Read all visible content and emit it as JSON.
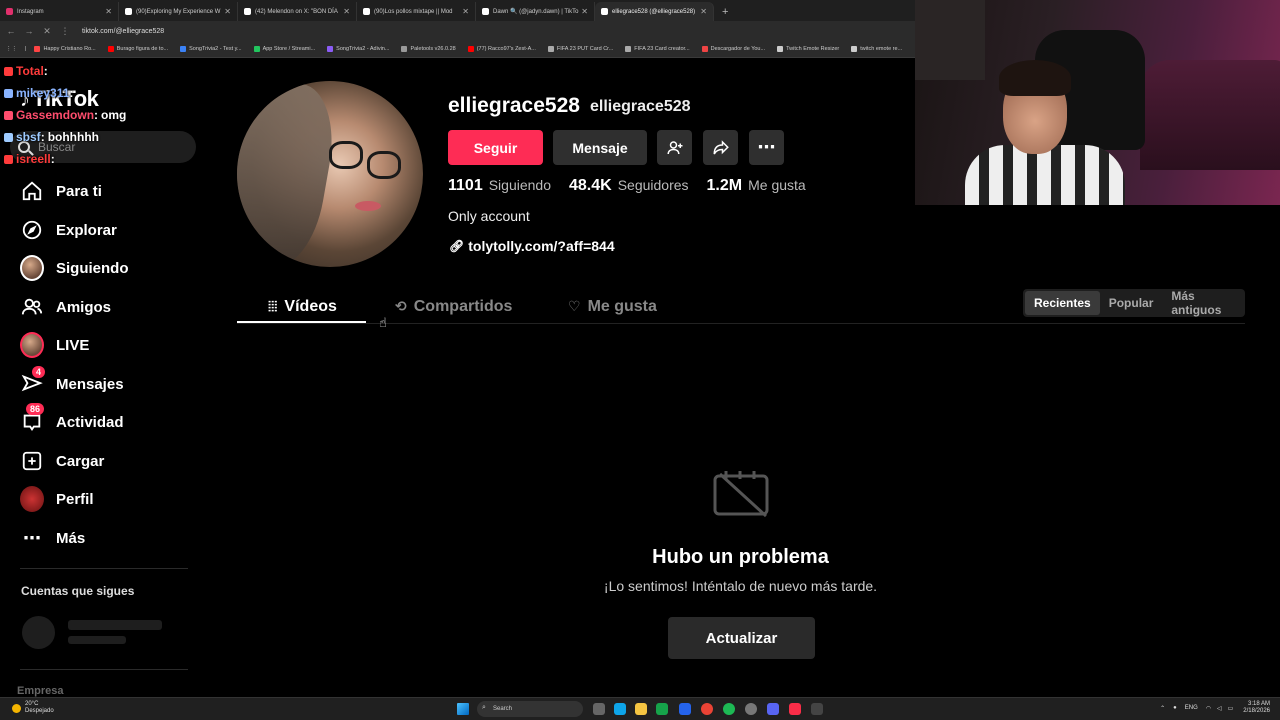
{
  "browser": {
    "tabs": [
      {
        "title": "Instagram",
        "color": "#e1306c"
      },
      {
        "title": "(90)Exploring My Experience W",
        "color": "#fff"
      },
      {
        "title": "(42) Melendon on X: \"BON DÍA",
        "color": "#fff"
      },
      {
        "title": "(90)Los pollos mixtape || Mod",
        "color": "#fff"
      },
      {
        "title": "Dawn 🔍 (@jadyn.dawn) | TikTo",
        "color": "#fff"
      },
      {
        "title": "elliegrace528 (@elliegrace528)",
        "color": "#fff"
      }
    ],
    "new_tab": "+",
    "url": "tiktok.com/@elliegrace528",
    "bookmarks": [
      {
        "label": "Happy Cristiano Ro...",
        "color": "#ff4444"
      },
      {
        "label": "Burago figura de to...",
        "color": "#ff0000"
      },
      {
        "label": "SongTrivia2 - Test y...",
        "color": "#3b82f6"
      },
      {
        "label": "App Store / Streami...",
        "color": "#22c55e"
      },
      {
        "label": "SongTrivia2 - Adivin...",
        "color": "#8b5cf6"
      },
      {
        "label": "Paletools v26.0.28",
        "color": "#999"
      },
      {
        "label": "(77) Racco97's Zest-A...",
        "color": "#ff0000"
      },
      {
        "label": "FIFA 23 PUT Card Cr...",
        "color": "#aaa"
      },
      {
        "label": "FIFA 23 Card creator...",
        "color": "#aaa"
      },
      {
        "label": "Descargador de You...",
        "color": "#ef4444"
      },
      {
        "label": "Twitch Emote Resizer",
        "color": "#ccc"
      },
      {
        "label": "twitch emote re...",
        "color": "#ccc"
      }
    ]
  },
  "chat": [
    {
      "user": "Total",
      "msg": "",
      "color": "#ff3b3b"
    },
    {
      "user": "mikey311",
      "msg": "",
      "color": "#8ab4ff"
    },
    {
      "user": "Gassemdown",
      "msg": "omg",
      "color": "#ff4d6d"
    },
    {
      "user": "sbsf",
      "msg": "bohhhhh",
      "color": "#9ecbff"
    },
    {
      "user": "isreell",
      "msg": "",
      "color": "#ff3b3b"
    }
  ],
  "sidebar": {
    "logo": "TikTok",
    "search_placeholder": "Buscar",
    "items": [
      {
        "label": "Para ti",
        "icon": "home-icon"
      },
      {
        "label": "Explorar",
        "icon": "compass-icon"
      },
      {
        "label": "Siguiendo",
        "icon": "avatar-icon"
      },
      {
        "label": "Amigos",
        "icon": "friends-icon"
      },
      {
        "label": "LIVE",
        "icon": "live-avatar-icon"
      },
      {
        "label": "Mensajes",
        "icon": "send-icon",
        "badge": "4"
      },
      {
        "label": "Actividad",
        "icon": "inbox-icon",
        "badge": "86"
      },
      {
        "label": "Cargar",
        "icon": "plus-square-icon"
      },
      {
        "label": "Perfil",
        "icon": "profile-avatar-icon"
      },
      {
        "label": "Más",
        "icon": "more-icon"
      }
    ],
    "following_title": "Cuentas que sigues",
    "footer_label": "Empresa"
  },
  "profile": {
    "username": "elliegrace528",
    "nickname": "elliegrace528",
    "follow_label": "Seguir",
    "message_label": "Mensaje",
    "stats": [
      {
        "value": "1101",
        "label": "Siguiendo"
      },
      {
        "value": "48.4K",
        "label": "Seguidores"
      },
      {
        "value": "1.2M",
        "label": "Me gusta"
      }
    ],
    "bio": "Only account",
    "link": "tolytolly.com/?aff=844",
    "tabs": [
      {
        "label": "Vídeos",
        "icon": "grid-icon"
      },
      {
        "label": "Compartidos",
        "icon": "repost-icon"
      },
      {
        "label": "Me gusta",
        "icon": "heart-lock-icon"
      }
    ],
    "sort": [
      "Recientes",
      "Popular",
      "Más antiguos"
    ],
    "accent": "#fe2c55"
  },
  "error": {
    "title": "Hubo un problema",
    "subtitle": "¡Lo sentimos! Inténtalo de nuevo más tarde.",
    "button": "Actualizar"
  },
  "taskbar": {
    "weather_temp": "20°C",
    "weather_desc": "Despejado",
    "search": "Search",
    "lang": "ENG",
    "time": "3:18 AM",
    "date": "2/18/2026"
  }
}
